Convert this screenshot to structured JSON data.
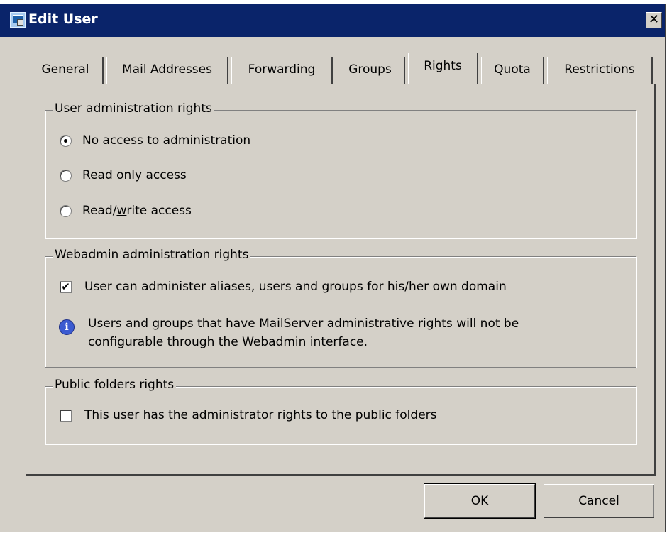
{
  "window": {
    "title": "Edit User",
    "close_label": "✕"
  },
  "tabs": [
    {
      "label": "General"
    },
    {
      "label": "Mail Addresses"
    },
    {
      "label": "Forwarding"
    },
    {
      "label": "Groups"
    },
    {
      "label": "Rights"
    },
    {
      "label": "Quota"
    },
    {
      "label": "Restrictions"
    }
  ],
  "active_tab": "Rights",
  "user_admin": {
    "title": "User administration rights",
    "options": [
      {
        "accel": "N",
        "rest": "o access to administration",
        "checked": true
      },
      {
        "accel": "R",
        "rest": "ead only access",
        "checked": false
      },
      {
        "pre": "Read/",
        "accel": "w",
        "rest": "rite access",
        "checked": false
      }
    ]
  },
  "webadmin": {
    "title": "Webadmin administration rights",
    "checkbox_label": "User can administer aliases, users and groups for his/her own domain",
    "checked": true,
    "info_line1": "Users and groups that have MailServer administrative rights will not be",
    "info_line2": "configurable through the Webadmin interface."
  },
  "public_folders": {
    "title": "Public folders rights",
    "checkbox_label": "This user has the administrator rights to the public folders",
    "checked": false
  },
  "buttons": {
    "ok": "OK",
    "cancel": "Cancel"
  }
}
